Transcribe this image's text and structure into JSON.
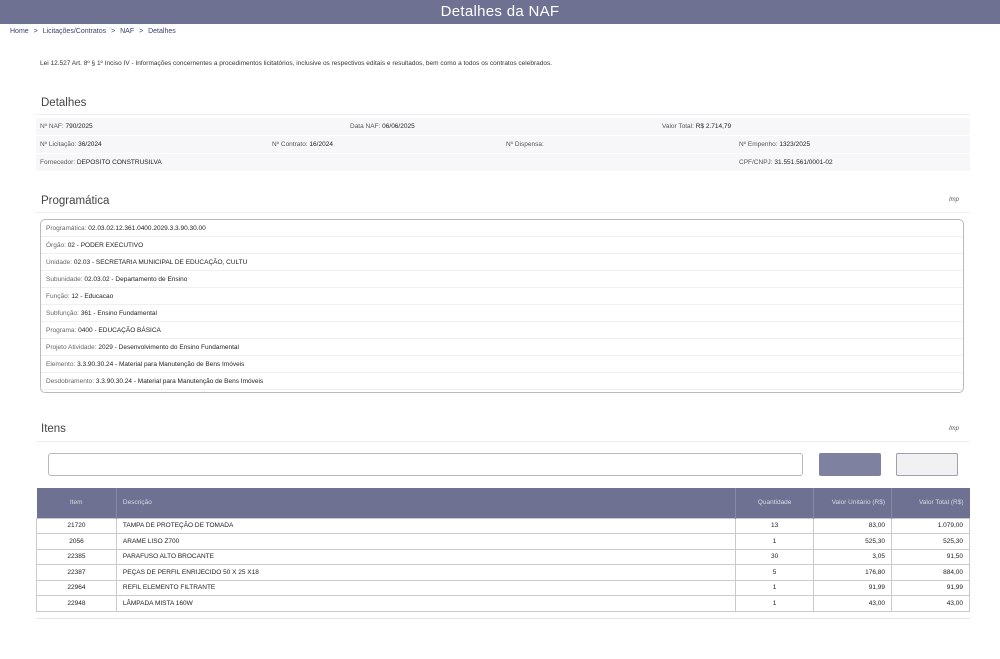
{
  "header": {
    "title": "Detalhes  da NAF"
  },
  "breadcrumb": [
    "Home",
    ">",
    "Licitações/Contratos",
    ">",
    "NAF",
    ">",
    "Detalhes"
  ],
  "lei_text": "Lei 12.527 Art. 8º § 1º Inciso IV - Informações concernentes a procedimentos licitatórios, inclusive os respectivos editais e resultados, bem como a todos os contratos celebrados.",
  "detalhes": {
    "title": "Detalhes",
    "naf_label": "Nº NAF:",
    "naf_value": "790/2025",
    "data_label": "Data NAF:",
    "data_value": "06/06/2025",
    "valor_label": "Valor Total:",
    "valor_value": "R$ 2.714,79",
    "licitacao_label": "Nº Licitação:",
    "licitacao_value": "36/2024",
    "contrato_label": "Nº Contrato:",
    "contrato_value": "16/2024",
    "dispensa_label": "Nº Dispensa:",
    "dispensa_value": "",
    "empenho_label": "Nº Empenho:",
    "empenho_value": "1323/2025",
    "fornecedor_label": "Fornecedor:",
    "fornecedor_value": "DEPOSITO CONSTRUSILVA",
    "cpf_label": "CPF/CNPJ:",
    "cpf_value": "31.551.561/0001-02"
  },
  "programatica": {
    "title": "Programática",
    "link": "Imp",
    "rows": [
      {
        "label": "Programática:",
        "value": "02.03.02.12.361.0400.2029.3.3.90.30.00"
      },
      {
        "label": "Órgão:",
        "value": "02 - PODER EXECUTIVO"
      },
      {
        "label": "Unidade:",
        "value": "02.03 - SECRETARIA MUNICIPAL DE EDUCAÇÃO, CULTU"
      },
      {
        "label": "Subunidade:",
        "value": "02.03.02 - Departamento de Ensino"
      },
      {
        "label": "Função:",
        "value": "12 - Educacao"
      },
      {
        "label": "Subfunção:",
        "value": "361 - Ensino Fundamental"
      },
      {
        "label": "Programa:",
        "value": "0400 - EDUCAÇÃO BÁSICA"
      },
      {
        "label": "Projeto Atividade:",
        "value": "2029 - Desenvolvimento do Ensino Fundamental"
      },
      {
        "label": "Elemento:",
        "value": "3.3.90.30.24 - Material para Manutenção de Bens Imóveis"
      },
      {
        "label": "Desdobramento:",
        "value": "3.3.90.30.24 - Material para Manutenção de Bens Imóveis"
      }
    ]
  },
  "itens": {
    "title": "Itens",
    "link": "Imp",
    "search_placeholder": "",
    "columns": [
      "Item",
      "Descrição",
      "Quantidade",
      "Valor Unitário (R$)",
      "Valor Total (R$)"
    ],
    "rows": [
      {
        "item": "21720",
        "desc": "TAMPA DE PROTEÇÃO DE TOMADA",
        "qty": "13",
        "unit": "83,00",
        "total": "1.079,00"
      },
      {
        "item": "2056",
        "desc": "ARAME LISO Z700",
        "qty": "1",
        "unit": "525,30",
        "total": "525,30"
      },
      {
        "item": "22385",
        "desc": "PARAFUSO ALTO BROCANTE",
        "qty": "30",
        "unit": "3,05",
        "total": "91,50"
      },
      {
        "item": "22387",
        "desc": "PEÇAS DE PERFIL ENRIJECIDO 50 X 25 X18",
        "qty": "5",
        "unit": "176,80",
        "total": "884,00"
      },
      {
        "item": "22964",
        "desc": "REFIL ELEMENTO FILTRANTE",
        "qty": "1",
        "unit": "91,99",
        "total": "91,99"
      },
      {
        "item": "22948",
        "desc": "LÂMPADA MISTA 160W",
        "qty": "1",
        "unit": "43,00",
        "total": "43,00"
      }
    ]
  }
}
